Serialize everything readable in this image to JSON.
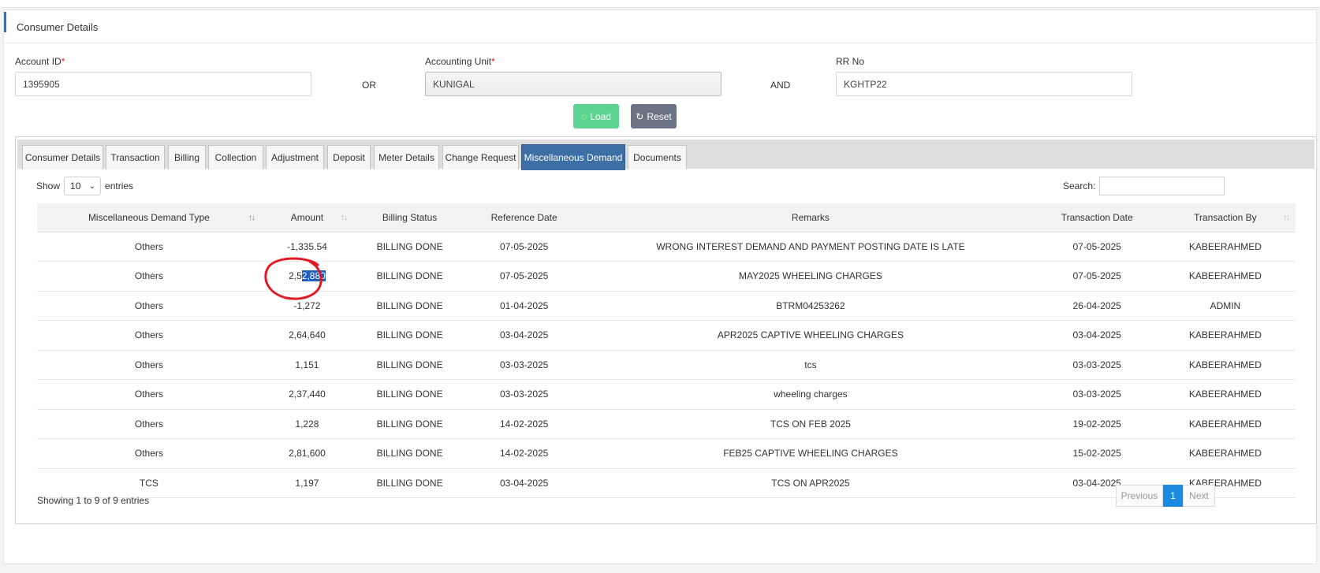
{
  "card": {
    "title": "Consumer Details"
  },
  "form": {
    "account_id": {
      "label": "Account ID",
      "required_mark": "*",
      "value": "1395905"
    },
    "or_label": "OR",
    "accounting_unit": {
      "label": "Accounting Unit",
      "required_mark": "*",
      "value": "KUNIGAL"
    },
    "and_label": "AND",
    "rr_no": {
      "label": "RR No",
      "value": "KGHTP22"
    },
    "load_label": "Load",
    "reset_label": "Reset"
  },
  "tabs": [
    "Consumer Details",
    "Transaction",
    "Billing",
    "Collection",
    "Adjustment",
    "Deposit",
    "Meter Details",
    "Change Request",
    "Miscellaneous Demand",
    "Documents"
  ],
  "active_tab": "Miscellaneous Demand",
  "table_controls": {
    "show_label": "Show",
    "entries_value": "10",
    "entries_label": "entries",
    "search_label": "Search:"
  },
  "table": {
    "headers": [
      "Miscellaneous Demand Type",
      "Amount",
      "Billing Status",
      "Reference Date",
      "Remarks",
      "Transaction Date",
      "Transaction By"
    ],
    "rows": [
      [
        "Others",
        "-1,335.54",
        "BILLING DONE",
        "07-05-2025",
        "WRONG INTEREST DEMAND AND PAYMENT POSTING DATE IS LATE",
        "07-05-2025",
        "KABEERAHMED"
      ],
      [
        "Others",
        "2,52,880",
        "BILLING DONE",
        "07-05-2025",
        "MAY2025 WHEELING CHARGES",
        "07-05-2025",
        "KABEERAHMED"
      ],
      [
        "Others",
        "-1,272",
        "BILLING DONE",
        "01-04-2025",
        "BTRM04253262",
        "26-04-2025",
        "ADMIN"
      ],
      [
        "Others",
        "2,64,640",
        "BILLING DONE",
        "03-04-2025",
        "APR2025 CAPTIVE WHEELING CHARGES",
        "03-04-2025",
        "KABEERAHMED"
      ],
      [
        "Others",
        "1,151",
        "BILLING DONE",
        "03-03-2025",
        "tcs",
        "03-03-2025",
        "KABEERAHMED"
      ],
      [
        "Others",
        "2,37,440",
        "BILLING DONE",
        "03-03-2025",
        "wheeling charges",
        "03-03-2025",
        "KABEERAHMED"
      ],
      [
        "Others",
        "1,228",
        "BILLING DONE",
        "14-02-2025",
        "TCS ON FEB 2025",
        "19-02-2025",
        "KABEERAHMED"
      ],
      [
        "Others",
        "2,81,600",
        "BILLING DONE",
        "14-02-2025",
        "FEB25 CAPTIVE WHEELING CHARGES",
        "15-02-2025",
        "KABEERAHMED"
      ],
      [
        "TCS",
        "1,197",
        "BILLING DONE",
        "03-04-2025",
        "TCS ON APR2025",
        "03-04-2025",
        "KABEERAHMED"
      ]
    ],
    "highlight": {
      "row": 1,
      "prefix": "2,5",
      "selected": "2,880"
    }
  },
  "footer": {
    "info": "Showing 1 to 9 of 9 entries",
    "previous_label": "Previous",
    "current_page": "1",
    "next_label": "Next"
  },
  "colors": {
    "active_tab": "#3d6fa5",
    "load_button": "#5cd48f",
    "reset_button": "#6c7384",
    "page_current": "#1b8ae0",
    "annotation": "#e01b24",
    "selection": "#1f5fbf"
  }
}
